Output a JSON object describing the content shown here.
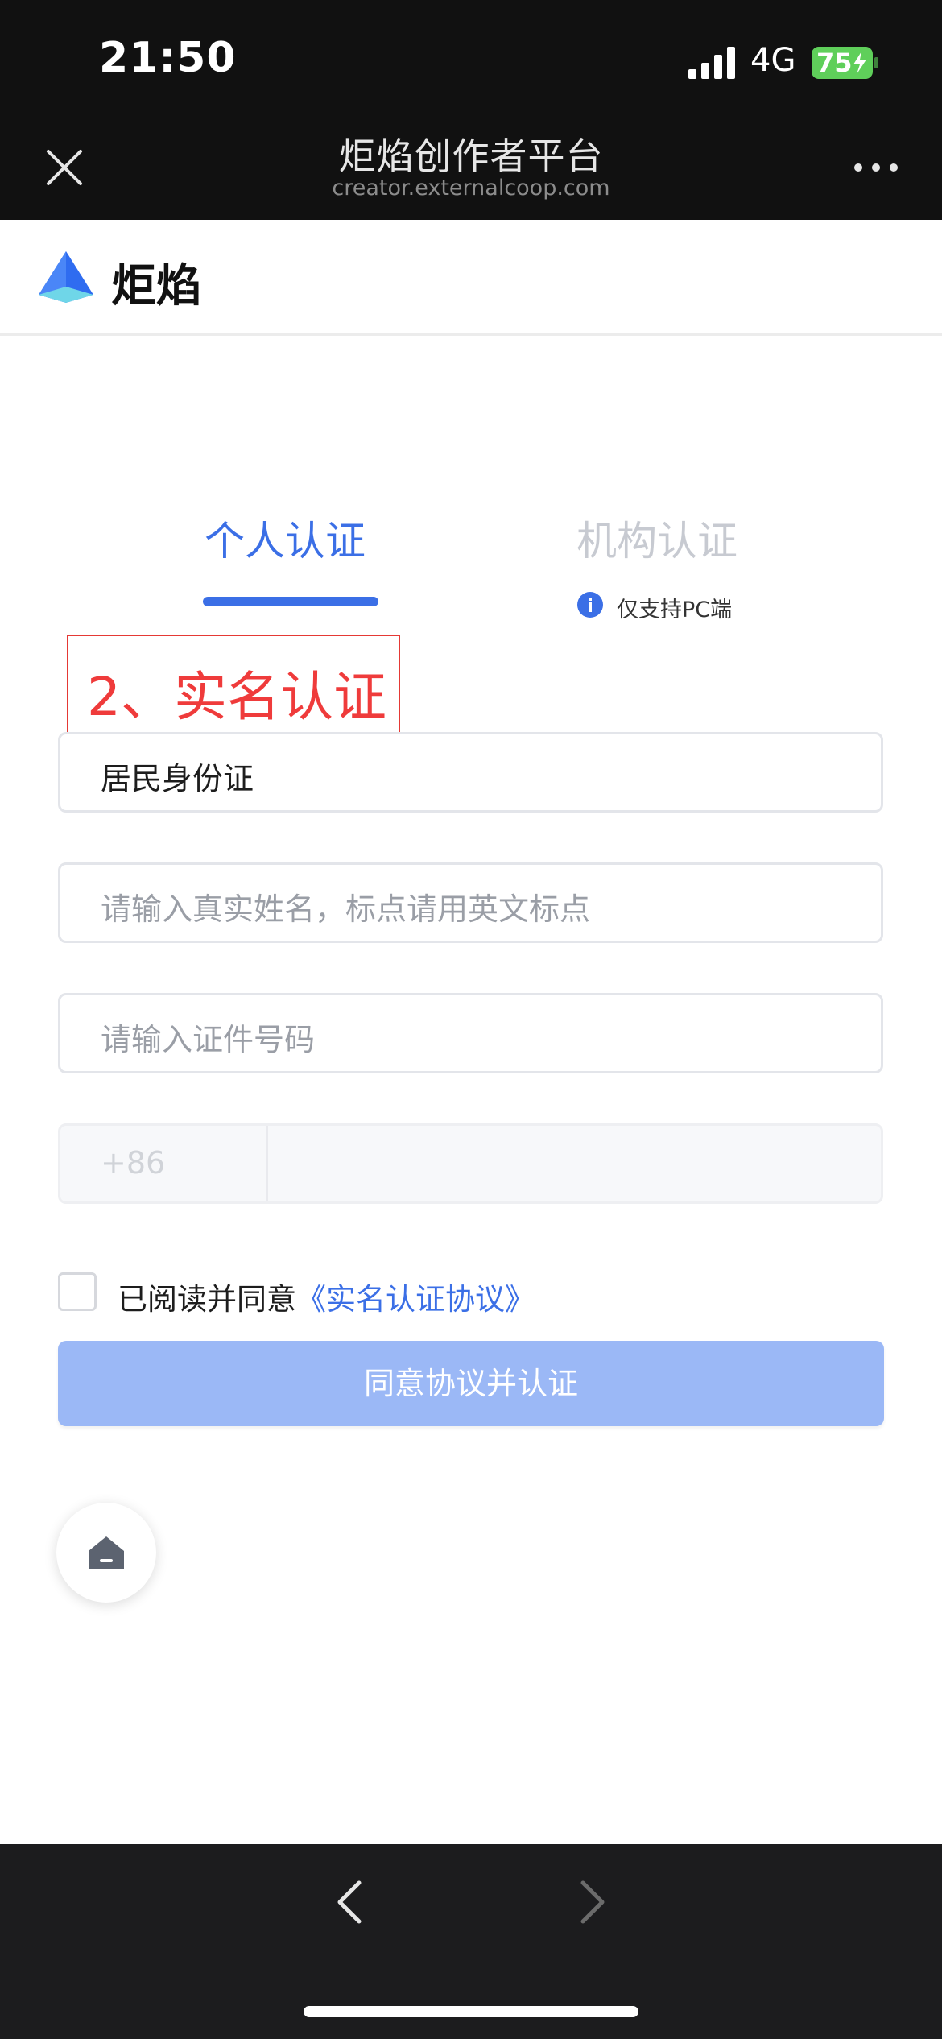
{
  "status_bar": {
    "time": "21:50",
    "carrier": "4G",
    "battery": "75",
    "icons": [
      "signal-bars-icon",
      "battery-charging-icon"
    ]
  },
  "title_bar": {
    "title": "炬焰创作者平台",
    "url": "creator.externalcoop.com",
    "icons": [
      "close-icon",
      "more-icon"
    ]
  },
  "header": {
    "brand_name": "炬焰",
    "logo_icon": "triangle-logo-icon"
  },
  "tabs": [
    {
      "label": "个人认证",
      "active": true
    },
    {
      "label": "机构认证",
      "active": false,
      "note": "仅支持PC端",
      "note_icon": "info-icon"
    }
  ],
  "annotation": {
    "step_label": "2、实名认证"
  },
  "form": {
    "id_type_value": "居民身份证",
    "name_placeholder": "请输入真实姓名，标点请用英文标点",
    "id_number_placeholder": "请输入证件号码",
    "phone_prefix": "+86",
    "phone_value": ""
  },
  "agreement": {
    "checked": false,
    "text": "已阅读并同意",
    "link_text": "《实名认证协议》"
  },
  "submit_button": {
    "label": "同意协议并认证"
  },
  "floating_home": {
    "icon": "home-icon"
  },
  "bottom_nav": {
    "icons": [
      "chevron-left-icon",
      "chevron-right-icon"
    ]
  },
  "colors": {
    "accent": "#3b6fe6",
    "button_disabled": "#9bb8f6",
    "annotation_red": "#ef3b3b",
    "topbar": "#111111",
    "bottombar": "#1c1c1e"
  }
}
